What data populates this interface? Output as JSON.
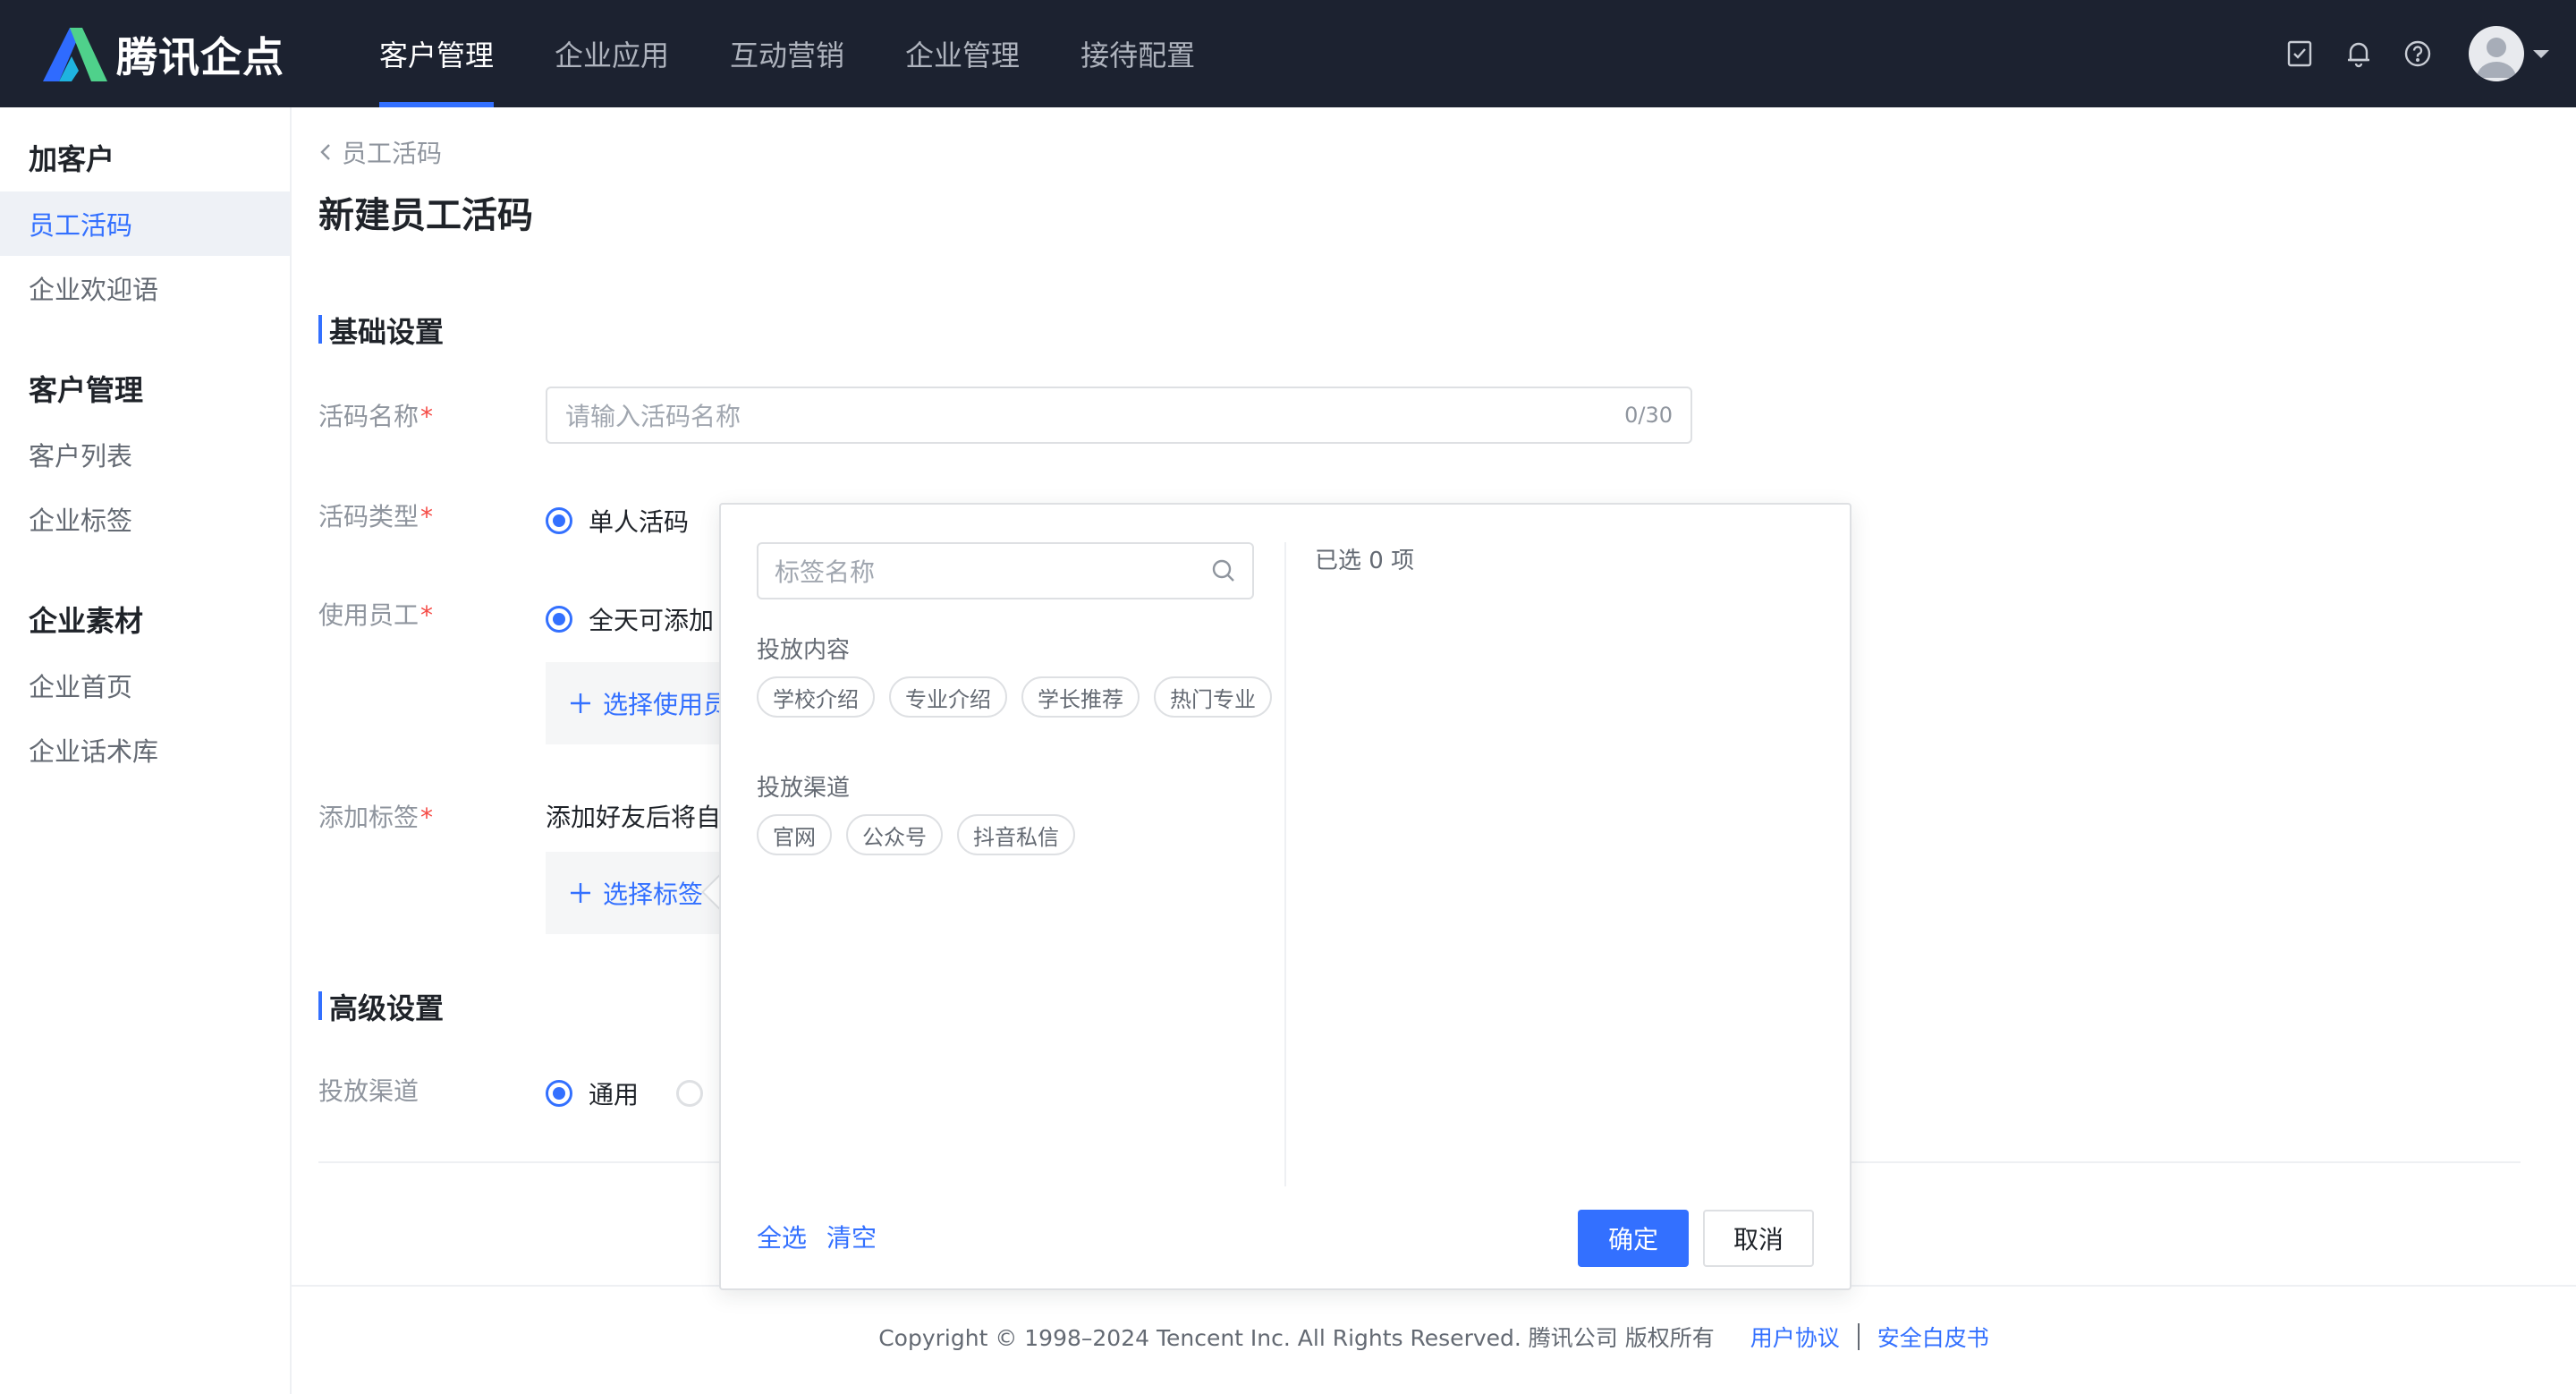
{
  "header": {
    "brand": "腾讯企点",
    "nav": [
      {
        "label": "客户管理",
        "active": true
      },
      {
        "label": "企业应用",
        "active": false
      },
      {
        "label": "互动营销",
        "active": false
      },
      {
        "label": "企业管理",
        "active": false
      },
      {
        "label": "接待配置",
        "active": false
      }
    ],
    "icons": [
      "task-check-icon",
      "bell-icon",
      "help-icon"
    ],
    "accent_color": "#3370ff"
  },
  "sidebar": {
    "groups": [
      {
        "title": "加客户",
        "items": [
          {
            "label": "员工活码",
            "active": true
          },
          {
            "label": "企业欢迎语",
            "active": false
          }
        ]
      },
      {
        "title": "客户管理",
        "items": [
          {
            "label": "客户列表",
            "active": false
          },
          {
            "label": "企业标签",
            "active": false
          }
        ]
      },
      {
        "title": "企业素材",
        "items": [
          {
            "label": "企业首页",
            "active": false
          },
          {
            "label": "企业话术库",
            "active": false
          }
        ]
      }
    ]
  },
  "main": {
    "breadcrumb": "员工活码",
    "title": "新建员工活码",
    "basic_section": "基础设置",
    "name_label": "活码名称",
    "name_placeholder": "请输入活码名称",
    "name_count": "0/30",
    "type_label": "活码类型",
    "type_option": "单人活码",
    "staff_label": "使用员工",
    "staff_option": "全天可添加",
    "staff_add": "选择使用员",
    "tag_label": "添加标签",
    "tag_desc": "添加好友后将自",
    "tag_add": "选择标签",
    "advanced_section": "高级设置",
    "channel_label": "投放渠道",
    "channel_option": "通用",
    "required_mark": "*"
  },
  "popover": {
    "search_placeholder": "标签名称",
    "groups": [
      {
        "title": "投放内容",
        "tags": [
          "学校介绍",
          "专业介绍",
          "学长推荐",
          "热门专业"
        ]
      },
      {
        "title": "投放渠道",
        "tags": [
          "官网",
          "公众号",
          "抖音私信"
        ]
      }
    ],
    "selected_text": "已选 0 项",
    "select_all": "全选",
    "clear": "清空",
    "confirm": "确定",
    "cancel": "取消"
  },
  "footer": {
    "copyright": "Copyright © 1998–2024 Tencent Inc. All Rights Reserved. 腾讯公司 版权所有",
    "user_agreement": "用户协议",
    "security_whitepaper": "安全白皮书"
  }
}
